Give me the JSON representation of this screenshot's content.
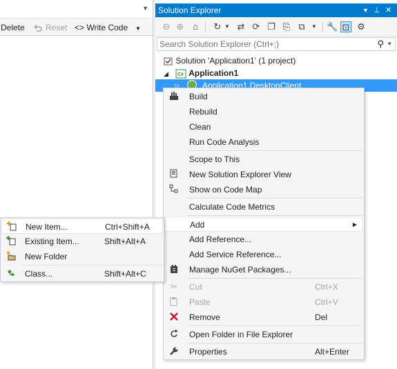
{
  "editor": {
    "toolbar": {
      "delete_label": "Delete",
      "reset_label": "Reset",
      "write_code_label": "<> Write Code"
    }
  },
  "solution_explorer": {
    "title": "Solution Explorer",
    "search_placeholder": "Search Solution Explorer (Ctrl+;)",
    "tree": {
      "solution": "Solution 'Application1' (1 project)",
      "project": "Application1",
      "selected_item": "Application1.DesktopClient"
    },
    "colors": {
      "title_bar": "#007acc",
      "selection": "#3399ff"
    }
  },
  "context_menu": {
    "items": [
      {
        "label": "Build",
        "icon": "build-icon"
      },
      {
        "label": "Rebuild"
      },
      {
        "label": "Clean"
      },
      {
        "label": "Run Code Analysis"
      },
      {
        "label": "Scope to This"
      },
      {
        "label": "New Solution Explorer View",
        "icon": "new-view-icon"
      },
      {
        "label": "Show on Code Map",
        "icon": "code-map-icon"
      },
      {
        "label": "Calculate Code Metrics"
      },
      {
        "label": "Add",
        "has_submenu": true
      },
      {
        "label": "Add Reference..."
      },
      {
        "label": "Add Service Reference..."
      },
      {
        "label": "Manage NuGet Packages...",
        "icon": "nuget-icon"
      },
      {
        "label": "Cut",
        "shortcut": "Ctrl+X",
        "disabled": true,
        "icon": "cut-icon"
      },
      {
        "label": "Paste",
        "shortcut": "Ctrl+V",
        "disabled": true,
        "icon": "paste-icon"
      },
      {
        "label": "Remove",
        "shortcut": "Del",
        "icon": "remove-icon"
      },
      {
        "label": "Open Folder in File Explorer",
        "icon": "open-folder-icon"
      },
      {
        "label": "Properties",
        "shortcut": "Alt+Enter",
        "icon": "wrench-icon"
      }
    ]
  },
  "add_submenu": {
    "items": [
      {
        "label": "New Item...",
        "shortcut": "Ctrl+Shift+A",
        "icon": "new-item-icon"
      },
      {
        "label": "Existing Item...",
        "shortcut": "Shift+Alt+A",
        "icon": "existing-item-icon"
      },
      {
        "label": "New Folder",
        "icon": "new-folder-icon"
      },
      {
        "label": "Class...",
        "shortcut": "Shift+Alt+C",
        "icon": "class-icon"
      }
    ]
  }
}
